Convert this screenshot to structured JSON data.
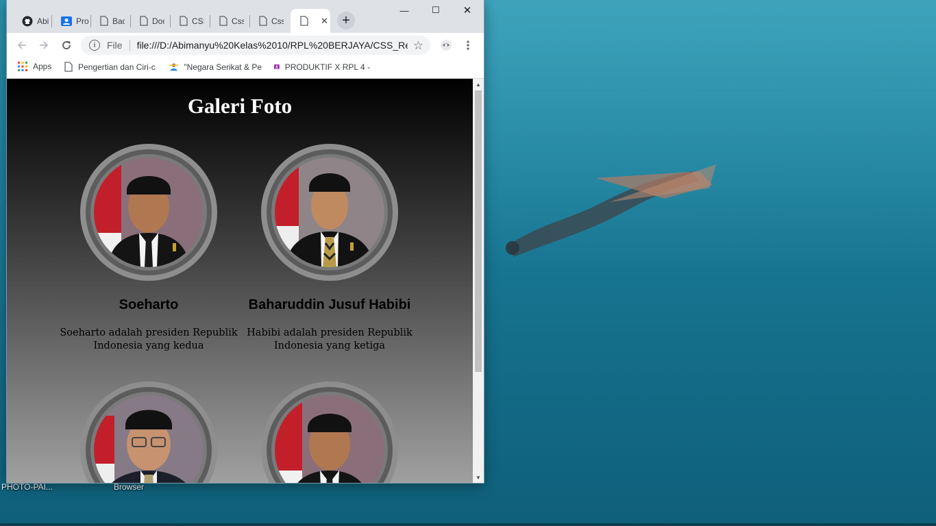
{
  "browser": {
    "tabs": [
      {
        "label": "Abi",
        "icon": "github-icon",
        "active": false
      },
      {
        "label": "Pro",
        "icon": "profile-card-icon",
        "active": false
      },
      {
        "label": "Bac",
        "icon": "page-icon",
        "active": false
      },
      {
        "label": "Doc",
        "icon": "page-icon",
        "active": false
      },
      {
        "label": "CSS",
        "icon": "page-icon",
        "active": false
      },
      {
        "label": "Css",
        "icon": "page-icon",
        "active": false
      },
      {
        "label": "Css",
        "icon": "page-icon",
        "active": false
      },
      {
        "label": "",
        "icon": "page-icon",
        "active": true
      }
    ],
    "close_tab_symbol": "✕",
    "new_tab_symbol": "+",
    "window_controls": {
      "minimize": "—",
      "maximize": "☐",
      "close": "✕"
    },
    "address": {
      "scheme_label": "File",
      "url": "file:///D:/Abimanyu%20Kelas%2010/RPL%20BERJAYA/CSS_Res..."
    },
    "bookmarks": [
      {
        "label": "Apps",
        "icon": "apps-grid-icon"
      },
      {
        "label": "Pengertian dan Ciri-c",
        "icon": "page-icon"
      },
      {
        "label": "\"Negara Serikat & Pe",
        "icon": "teacher-icon"
      },
      {
        "label": "PRODUKTIF X RPL 4 -",
        "icon": "classroom-icon"
      }
    ]
  },
  "page": {
    "title": "Galeri Foto",
    "cards": [
      {
        "name": "Soeharto",
        "description": "Soeharto adalah presiden Republik Indonesia yang kedua",
        "tie": "dark"
      },
      {
        "name": "Baharuddin Jusuf Habibi",
        "description": "Habibi adalah presiden Republik Indonesia yang ketiga",
        "tie": "patterned"
      },
      {
        "name": "",
        "description": "",
        "tie": "patterned",
        "glasses": true
      },
      {
        "name": "",
        "description": "",
        "tie": "dark"
      }
    ]
  },
  "desktop": {
    "icons": [
      {
        "label": "PHOTO-PAI..."
      },
      {
        "label": "Browser"
      }
    ]
  },
  "colors": {
    "titlebar": "#dee1e6",
    "page_gradient_top": "#000000",
    "page_gradient_bottom": "#a0a0a0",
    "ring": "#8e8e8e"
  }
}
